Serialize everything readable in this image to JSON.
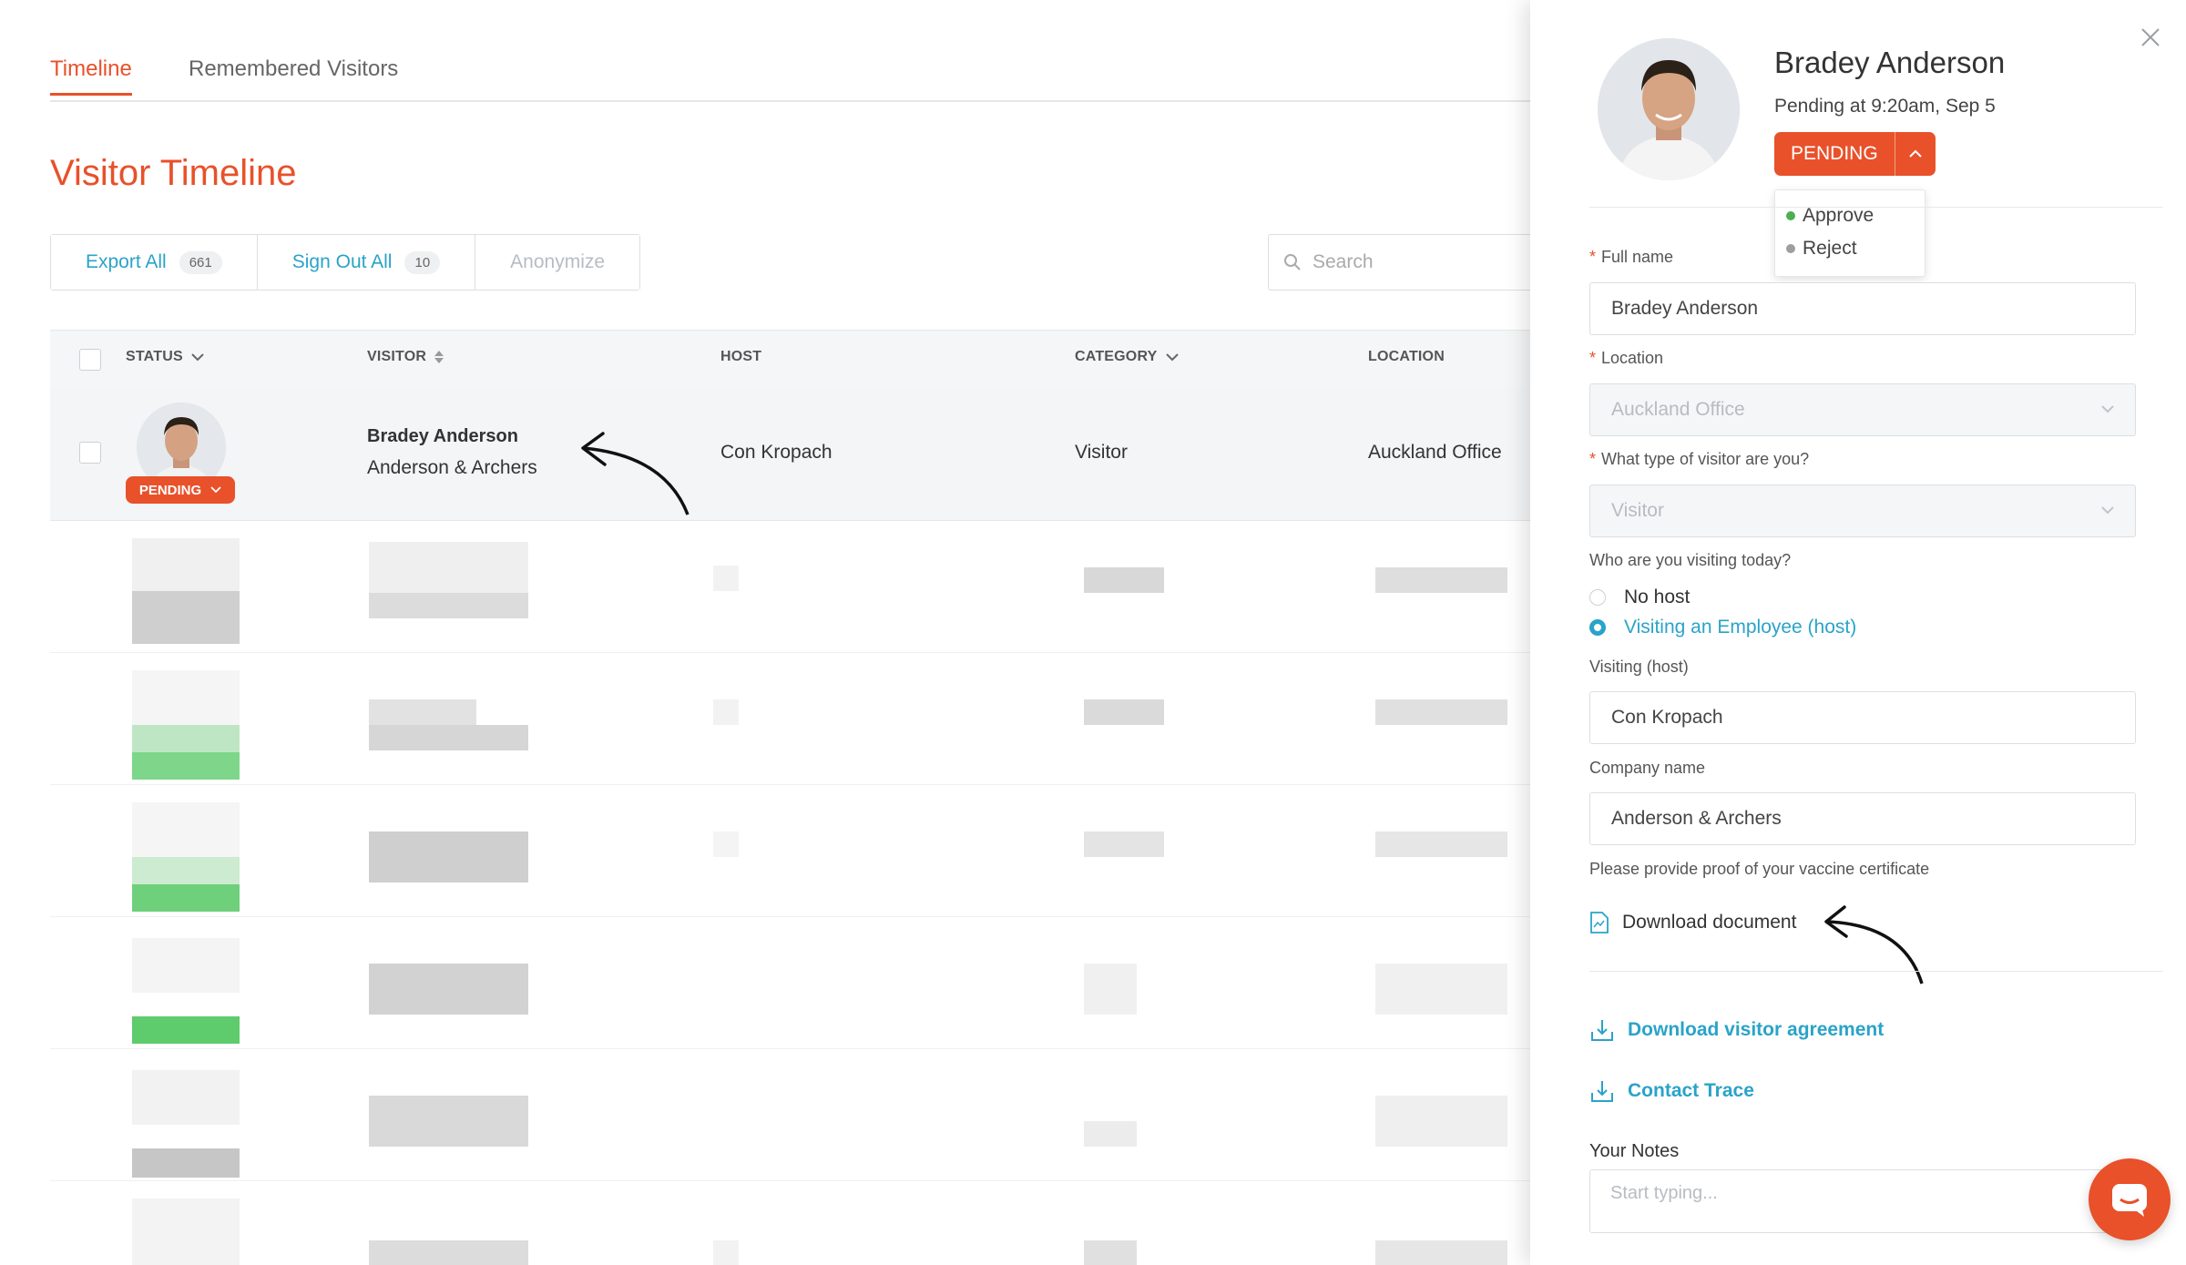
{
  "tabs": [
    {
      "label": "Timeline",
      "active": true
    },
    {
      "label": "Remembered Visitors",
      "active": false
    }
  ],
  "page_title": "Visitor Timeline",
  "actions": {
    "export_all": "Export All",
    "export_count": "661",
    "sign_out_all": "Sign Out All",
    "sign_out_count": "10",
    "anonymize": "Anonymize"
  },
  "search": {
    "placeholder": "Search"
  },
  "table": {
    "headers": {
      "status": "STATUS",
      "visitor": "VISITOR",
      "host": "HOST",
      "category": "CATEGORY",
      "location": "LOCATION"
    },
    "row": {
      "status": "PENDING",
      "visitor_name": "Bradey Anderson",
      "visitor_company": "Anderson & Archers",
      "host": "Con Kropach",
      "category": "Visitor",
      "location": "Auckland Office"
    }
  },
  "panel": {
    "name": "Bradey Anderson",
    "status_line": "Pending at 9:20am, Sep 5",
    "status_button": "PENDING",
    "dropdown": [
      {
        "label": "Approve",
        "color": "#4caf50"
      },
      {
        "label": "Reject",
        "color": "#9e9e9e"
      }
    ],
    "full_name_label": "Full name",
    "full_name_value": "Bradey Anderson",
    "location_label": "Location",
    "location_value": "Auckland Office",
    "visitor_type_label": "What type of visitor are you?",
    "visitor_type_value": "Visitor",
    "visiting_question": "Who are you visiting today?",
    "radio_no_host": "No host",
    "radio_employee": "Visiting an Employee (host)",
    "visiting_host_label": "Visiting (host)",
    "visiting_host_value": "Con Kropach",
    "company_label": "Company name",
    "company_value": "Anderson & Archers",
    "vaccine_label": "Please provide proof of your vaccine certificate",
    "download_document": "Download document",
    "download_agreement": "Download visitor agreement",
    "contact_trace": "Contact Trace",
    "notes_label": "Your Notes",
    "notes_placeholder": "Start typing..."
  },
  "colors": {
    "accent": "#e8512a",
    "link": "#2aa3c9",
    "approve": "#4caf50",
    "reject": "#9e9e9e"
  }
}
